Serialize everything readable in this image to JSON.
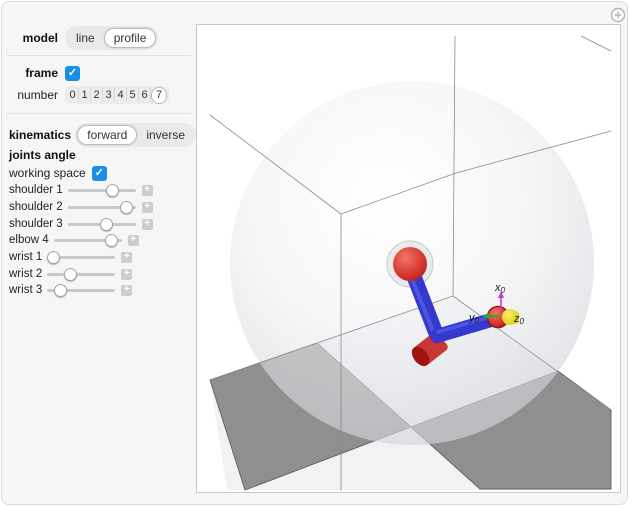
{
  "colors": {
    "accent": "#1b8fe8",
    "link_blue": "#3538cf",
    "link_blue_light": "#5a60e8",
    "joint_red": "#c62725",
    "joint_red_dark": "#9e1412",
    "effector_yellow": "#e3d613",
    "slab_gray": "#8f8f8f",
    "slab_edge": "#5f5f5f",
    "axis_x_magenta": "#cb3ccb",
    "axis_y_green": "#18b418",
    "wireframe_gray": "#8a8a8a"
  },
  "sidebar": {
    "model": {
      "label": "model",
      "options": [
        "line",
        "profile"
      ],
      "selected": "profile"
    },
    "frame": {
      "label": "frame",
      "checked": true,
      "checkmark": "✓"
    },
    "number": {
      "label": "number",
      "options": [
        "0",
        "1",
        "2",
        "3",
        "4",
        "5",
        "6",
        "7"
      ],
      "selected": "7"
    },
    "kinematics": {
      "label": "kinematics",
      "options": [
        "forward",
        "inverse"
      ],
      "selected": "forward"
    },
    "joints_angle_heading": "joints angle",
    "working_space": {
      "label": "working space",
      "checked": true,
      "checkmark": "✓"
    },
    "slider_expander_glyph": "+",
    "sliders": [
      {
        "label": "shoulder 1",
        "fraction": 0.66
      },
      {
        "label": "shoulder 2",
        "fraction": 0.86
      },
      {
        "label": "shoulder 3",
        "fraction": 0.57
      },
      {
        "label": "elbow 4",
        "fraction": 0.85
      },
      {
        "label": "wrist 1",
        "fraction": 0.09
      },
      {
        "label": "wrist 2",
        "fraction": 0.34
      },
      {
        "label": "wrist 3",
        "fraction": 0.2
      }
    ]
  },
  "viewport": {
    "options_button_glyph": "+",
    "frame_labels": {
      "x": {
        "base": "x",
        "sub": "0"
      },
      "y": {
        "base": "y",
        "sub": "0"
      },
      "z": {
        "base": "z",
        "sub": "0"
      }
    }
  }
}
